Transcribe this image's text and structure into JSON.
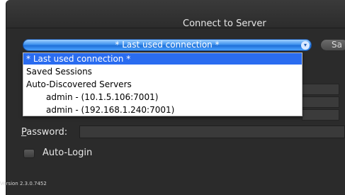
{
  "window": {
    "title": "Connect to Server"
  },
  "connection_select": {
    "selected_label": "* Last used connection *",
    "side_button_label": "Sa"
  },
  "dropdown": {
    "items": [
      {
        "label": "* Last used connection *",
        "selected": true
      },
      {
        "label": "Saved Sessions",
        "selected": false
      },
      {
        "label": "Auto-Discovered Servers",
        "selected": false
      },
      {
        "label": "admin - (10.1.5.106:7001)",
        "selected": false
      },
      {
        "label": "admin - (192.168.1.240:7001)",
        "selected": false
      }
    ]
  },
  "password": {
    "label_first": "P",
    "label_rest": "assword:",
    "value": ""
  },
  "auto_login": {
    "label": "Auto-Login",
    "checked": false
  },
  "footer": {
    "version": "Version 2.3.0.7452"
  },
  "colors": {
    "accent": "#2a6cf0",
    "window_bg": "#2b2b2b"
  }
}
